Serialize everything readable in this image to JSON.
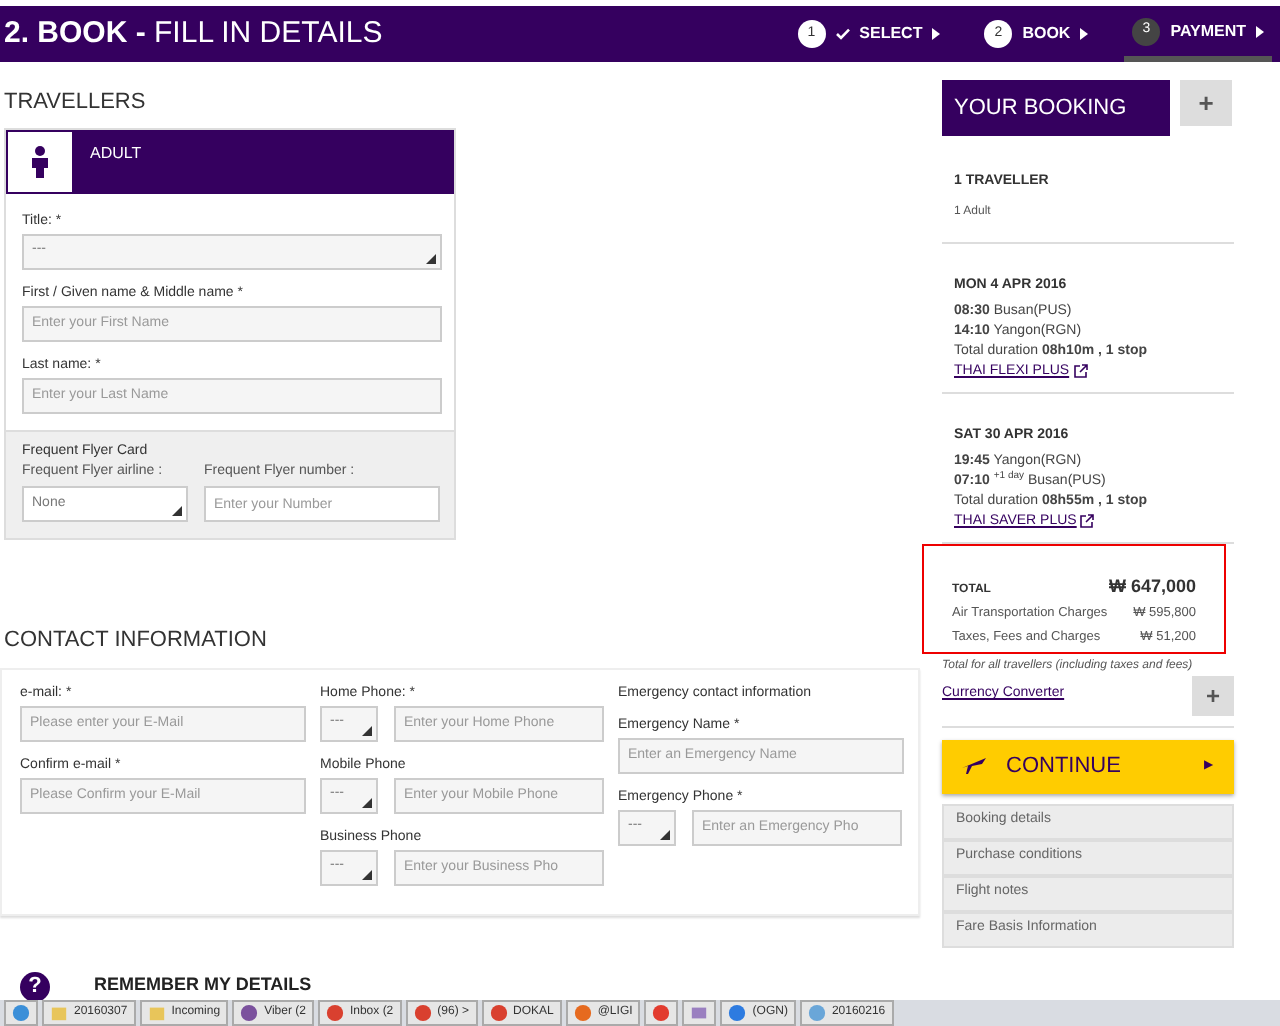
{
  "header": {
    "title_bold": "2. BOOK -",
    "title_rest": "FILL IN DETAILS",
    "steps": [
      {
        "number": "1",
        "label": "SELECT",
        "done": true,
        "selected": false
      },
      {
        "number": "2",
        "label": "BOOK",
        "done": false,
        "selected": false
      },
      {
        "number": "3",
        "label": "PAYMENT",
        "done": false,
        "selected": true
      }
    ]
  },
  "travellers": {
    "heading": "TRAVELLERS",
    "type": "ADULT",
    "fields": [
      {
        "label": "Title: *",
        "kind": "select",
        "value": "---"
      },
      {
        "label": "First / Given name & Middle name *",
        "kind": "text",
        "placeholder": "Enter your First Name"
      },
      {
        "label": "Last name: *",
        "kind": "text",
        "placeholder": "Enter your Last Name"
      }
    ],
    "frequent_flyer": {
      "heading": "Frequent Flyer Card",
      "airline_label": "Frequent Flyer airline :",
      "airline_value": "None",
      "number_label": "Frequent Flyer number :",
      "number_placeholder": "Enter your Number"
    }
  },
  "contact": {
    "heading": "CONTACT INFORMATION",
    "email": [
      {
        "label": "e-mail: *",
        "placeholder": "Please enter your E-Mail"
      },
      {
        "label": "Confirm e-mail *",
        "placeholder": "Please Confirm your E-Mail"
      }
    ],
    "phones": [
      {
        "label": "Home Phone: *",
        "code": "---",
        "placeholder": "Enter your Home Phone"
      },
      {
        "label": "Mobile Phone",
        "code": "---",
        "placeholder": "Enter your Mobile Phone"
      },
      {
        "label": "Business Phone",
        "code": "---",
        "placeholder": "Enter your Business Pho"
      }
    ],
    "emergency": {
      "heading": "Emergency contact information",
      "name_label": "Emergency Name *",
      "name_placeholder": "Enter an Emergency Name",
      "phone_label": "Emergency Phone *",
      "phone_code": "---",
      "phone_placeholder": "Enter an Emergency Pho"
    }
  },
  "remember": {
    "icon": "?",
    "heading": "REMEMBER MY DETAILS"
  },
  "booking": {
    "title": "YOUR BOOKING",
    "add": "+",
    "travellers_title": "1 TRAVELLER",
    "travellers_detail": "1 Adult",
    "flights": [
      {
        "date": "MON 4 APR 2016",
        "depart_time": "08:30",
        "depart_place": "Busan(PUS)",
        "arrive_time": "14:10",
        "arrive_place": "Yangon(RGN)",
        "duration_label": "Total duration",
        "duration": "08h10m , 1 stop",
        "fare": "THAI FLEXI PLUS"
      },
      {
        "date": "SAT 30 APR 2016",
        "depart_time": "19:45",
        "depart_place": "Yangon(RGN)",
        "arrive_time": "07:10",
        "arrive_note": "+1 day",
        "arrive_place": "Busan(PUS)",
        "duration_label": "Total duration",
        "duration": "08h55m , 1 stop",
        "fare": "THAI SAVER PLUS"
      }
    ],
    "total": {
      "label": "TOTAL",
      "amount": "₩ 647,000",
      "lines": [
        {
          "label": "Air Transportation Charges",
          "amount": "₩ 595,800"
        },
        {
          "label": "Taxes, Fees and Charges",
          "amount": "₩ 51,200"
        }
      ],
      "highlighted": true
    },
    "note": "Total for all travellers (including taxes and fees)",
    "converter": "Currency Converter",
    "converter_add": "+",
    "continue": "CONTINUE",
    "continue_arrow": "▶",
    "links": [
      "Booking details",
      "Purchase conditions",
      "Flight notes",
      "Fare Basis Information"
    ]
  },
  "taskbar": {
    "items": [
      {
        "kind": "ie"
      },
      {
        "kind": "folder",
        "label": "20160307"
      },
      {
        "kind": "folder",
        "label": "Incoming"
      },
      {
        "kind": "viber",
        "label": "Viber (2"
      },
      {
        "kind": "chrome",
        "label": "Inbox (2"
      },
      {
        "kind": "chrome",
        "label": "(96) >"
      },
      {
        "kind": "chrome",
        "label": "DOKAL"
      },
      {
        "kind": "firefox",
        "label": "@LIGI"
      },
      {
        "kind": "app"
      },
      {
        "kind": "mail"
      },
      {
        "kind": "send",
        "label": "(OGN)"
      },
      {
        "kind": "files",
        "label": "20160216"
      }
    ]
  }
}
